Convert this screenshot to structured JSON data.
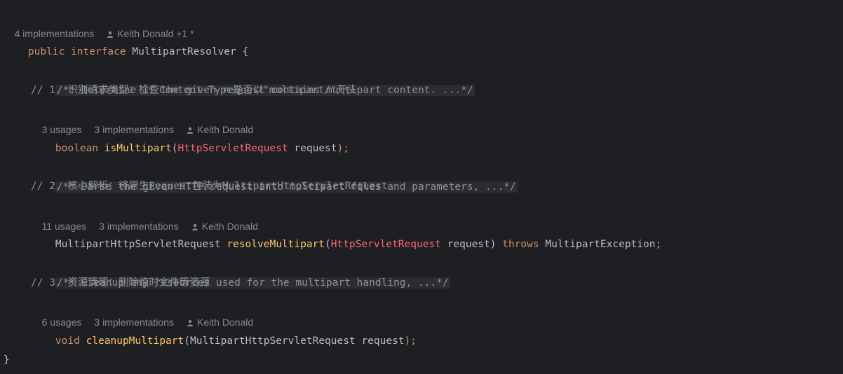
{
  "header_hint": {
    "implementations": "4 implementations",
    "author": "Keith Donald +1 *"
  },
  "interface_decl": {
    "kw_public": "public",
    "kw_interface": "interface",
    "name": "MultipartResolver",
    "open_brace": "{",
    "close_brace": "}"
  },
  "methods": [
    {
      "doc": "/** Determine if the given request contains multipart content. ...*/",
      "comment": "// 1. 识别请求类型：检查Content-Type是否以\"multipart/\"开头",
      "usages": "3 usages",
      "implementations": "3 implementations",
      "author": "Keith Donald",
      "return_type": "boolean",
      "name": "isMultipart",
      "open_paren": "(",
      "param_type": "HttpServletRequest",
      "param_name": "request",
      "close": ");",
      "throws_kw": "",
      "throws_type": ""
    },
    {
      "doc": "/** Parse the given HTTP request into multipart files and parameters, ...*/",
      "comment": "// 2. 核心解析：将原生Request包装为MultipartHttpServletRequest",
      "usages": "11 usages",
      "implementations": "3 implementations",
      "author": "Keith Donald",
      "return_type": "MultipartHttpServletRequest",
      "name": "resolveMultipart",
      "open_paren": "(",
      "param_type": "HttpServletRequest",
      "param_name": "request",
      "close": ")",
      "throws_kw": "throws",
      "throws_type": "MultipartException"
    },
    {
      "doc": "/** Cleanup any resources used for the multipart handling, ...*/",
      "comment": "// 3. 资源清理：删除临时文件等资源",
      "usages": "6 usages",
      "implementations": "3 implementations",
      "author": "Keith Donald",
      "return_type": "void",
      "name": "cleanupMultipart",
      "open_paren": "(",
      "param_type": "MultipartHttpServletRequest",
      "param_name": "request",
      "close": ");",
      "throws_kw": "",
      "throws_type": ""
    }
  ],
  "colors": {
    "background": "#1e1f22",
    "keyword": "#cf8e6d",
    "method": "#ffc66d",
    "error_type": "#fa6675",
    "text": "#bcbec4",
    "hint": "#868a91",
    "doc_bg": "#2b2d30"
  }
}
